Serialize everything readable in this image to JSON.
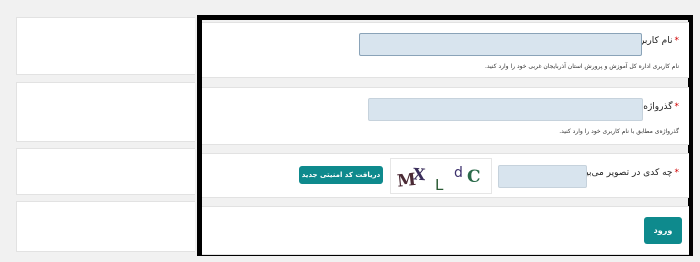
{
  "form": {
    "username": {
      "label": "نام کاربری",
      "required_mark": "*",
      "hint": "نام کاربری اداره کل آموزش و پرورش استان آذربایجان غربی خود را وارد کنید.",
      "value": ""
    },
    "password": {
      "label": "گذرواژه",
      "required_mark": "*",
      "hint": "گذرواژه‌ی مطابق با نام کاربری خود را وارد کنید.",
      "value": ""
    },
    "captcha": {
      "label": "چه کدی در تصویر می‌بینید؟",
      "required_mark": "*",
      "image_text": [
        "M",
        "X",
        "L",
        "d",
        "C"
      ],
      "refresh_label": "دریافت کد امنیتی جدید",
      "value": ""
    },
    "submit_label": "ورود"
  },
  "colors": {
    "accent": "#0e8a8d",
    "input_bg": "#d8e4ee",
    "required": "#d00000",
    "frame": "#000000"
  }
}
